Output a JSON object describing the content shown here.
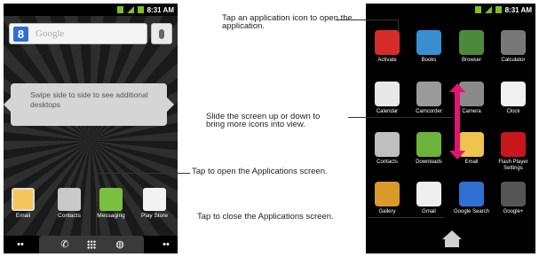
{
  "status_bar": {
    "time": "8:31 AM"
  },
  "home_screen": {
    "search": {
      "placeholder": "Google",
      "logo": "8"
    },
    "hint": "Swipe side to side to see additional desktops",
    "dock": [
      {
        "label": "Email",
        "icon": "email-icon"
      },
      {
        "label": "Contacts",
        "icon": "contacts-icon"
      },
      {
        "label": "Messaging",
        "icon": "messaging-icon"
      },
      {
        "label": "Play Store",
        "icon": "play-store-icon"
      }
    ],
    "nav": {
      "dots": "••",
      "phone": "✆",
      "browser": "◍"
    }
  },
  "apps_screen": {
    "apps": [
      {
        "label": "Activate",
        "color": "#d62b2b"
      },
      {
        "label": "Books",
        "color": "#3a8fd0"
      },
      {
        "label": "Browser",
        "color": "#4a8a3a"
      },
      {
        "label": "Calculator",
        "color": "#777777"
      },
      {
        "label": "Calendar",
        "color": "#e8e8e8"
      },
      {
        "label": "Camcorder",
        "color": "#9a9a9a"
      },
      {
        "label": "Camera",
        "color": "#8a8a8a"
      },
      {
        "label": "Clock",
        "color": "#f0f0f0"
      },
      {
        "label": "Contacts",
        "color": "#bfbfbf"
      },
      {
        "label": "Downloads",
        "color": "#6bb33a"
      },
      {
        "label": "Email",
        "color": "#f0c24e"
      },
      {
        "label": "Flash Player Settings",
        "color": "#c8161d"
      },
      {
        "label": "Gallery",
        "color": "#d99a2b"
      },
      {
        "label": "Gmail",
        "color": "#eeeeee"
      },
      {
        "label": "Google Search",
        "color": "#2f6fd1"
      },
      {
        "label": "Google+",
        "color": "#555555"
      }
    ]
  },
  "callouts": {
    "tap_icon": "Tap an application icon to open the application.",
    "slide": "Slide the screen up or down to bring more icons into view.",
    "tap_open": "Tap to open the Applications screen.",
    "tap_close": "Tap to close the Applications screen."
  },
  "colors": {
    "accent": "#e0156f"
  }
}
